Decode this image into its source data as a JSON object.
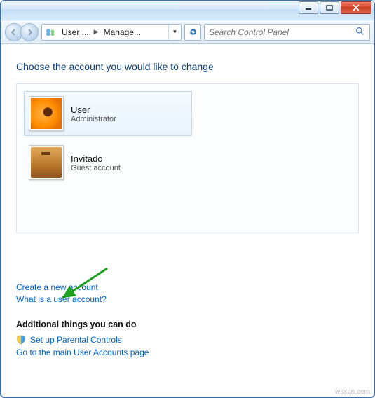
{
  "breadcrumb": {
    "seg1": "User ...",
    "seg2": "Manage..."
  },
  "search": {
    "placeholder": "Search Control Panel"
  },
  "page": {
    "heading": "Choose the account you would like to change"
  },
  "accounts": [
    {
      "name": "User",
      "role": "Administrator",
      "avatar": "flower",
      "selected": true
    },
    {
      "name": "Invitado",
      "role": "Guest account",
      "avatar": "suitcase",
      "selected": false
    }
  ],
  "links": {
    "create": "Create a new account",
    "whatis": "What is a user account?"
  },
  "additional": {
    "heading": "Additional things you can do",
    "parental": "Set up Parental Controls",
    "mainpage": "Go to the main User Accounts page"
  },
  "watermark": "wsxdn.com"
}
